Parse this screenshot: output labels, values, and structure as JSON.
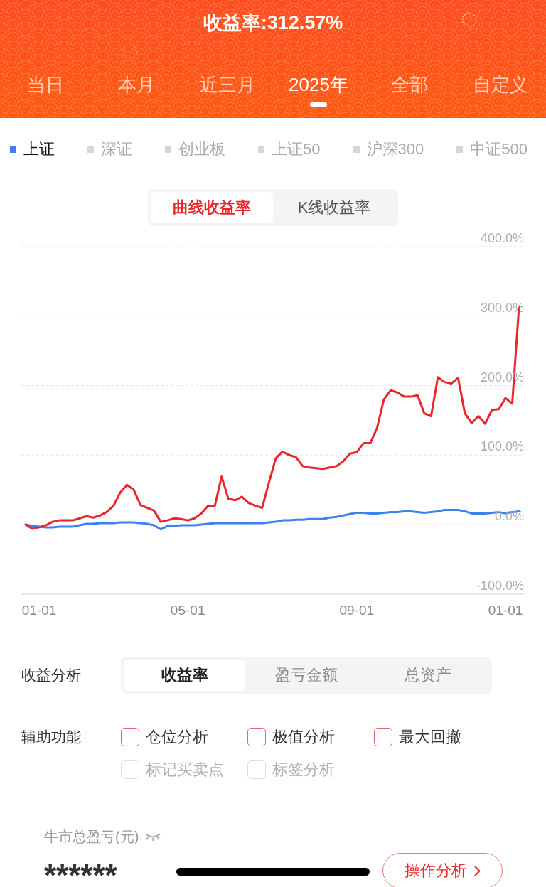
{
  "header": {
    "title": "收益率:312.57%",
    "tabs": [
      {
        "label": "当日",
        "selected": false
      },
      {
        "label": "本月",
        "selected": false
      },
      {
        "label": "近三月",
        "selected": false
      },
      {
        "label": "2025年",
        "selected": true
      },
      {
        "label": "全部",
        "selected": false
      },
      {
        "label": "自定义",
        "selected": false
      }
    ]
  },
  "benchmarks": [
    {
      "label": "上证",
      "selected": true
    },
    {
      "label": "深证",
      "selected": false
    },
    {
      "label": "创业板",
      "selected": false
    },
    {
      "label": "上证50",
      "selected": false
    },
    {
      "label": "沪深300",
      "selected": false
    },
    {
      "label": "中证500",
      "selected": false
    }
  ],
  "chart_modes": [
    {
      "label": "曲线收益率",
      "selected": true
    },
    {
      "label": "K线收益率",
      "selected": false
    }
  ],
  "chart": {
    "chart_data": {
      "type": "line",
      "grid": true,
      "categories": [
        null,
        null,
        "01-01",
        null,
        null,
        null,
        null,
        null,
        null,
        null,
        null,
        null,
        null,
        null,
        null,
        null,
        null,
        null,
        null,
        null,
        null,
        null,
        null,
        null,
        "05-01",
        null,
        null,
        null,
        null,
        null,
        null,
        null,
        null,
        null,
        null,
        null,
        null,
        null,
        null,
        null,
        null,
        null,
        null,
        null,
        null,
        null,
        null,
        null,
        null,
        "09-01",
        null,
        null,
        null,
        null,
        null,
        null,
        null,
        null,
        null,
        null,
        null,
        null,
        null,
        null,
        null,
        null,
        null,
        null,
        null,
        null,
        null,
        "01-01",
        null,
        null
      ],
      "ylim": [
        -100,
        400
      ],
      "yticks": [
        {
          "value": 400,
          "label": "400.0%"
        },
        {
          "value": 300,
          "label": "300.0%"
        },
        {
          "value": 200,
          "label": "200.0%"
        },
        {
          "value": 100,
          "label": "100.0%"
        },
        {
          "value": 0,
          "label": "0.0%"
        },
        {
          "value": -100,
          "label": "-100.0%"
        }
      ],
      "series": [
        {
          "color": "#e8262b",
          "values": [
            0,
            -6,
            -4,
            -1,
            4,
            6,
            6,
            6,
            9,
            12,
            10,
            13,
            18,
            27,
            46,
            57,
            50,
            28,
            24,
            20,
            4,
            6,
            9,
            8,
            6,
            9,
            16,
            27,
            27,
            69,
            37,
            35,
            40,
            31,
            27,
            24,
            60,
            95,
            105,
            100,
            97,
            84,
            82,
            81,
            80,
            82,
            84,
            91,
            102,
            104,
            117,
            117,
            139,
            180,
            193,
            190,
            184,
            184,
            186,
            160,
            156,
            212,
            205,
            203,
            211,
            160,
            146,
            156,
            145,
            165,
            166,
            182,
            174,
            313
          ]
        },
        {
          "color": "#3b82f0",
          "values": [
            0,
            -2,
            -3,
            -4,
            -4,
            -3,
            -3,
            -3,
            -1,
            1,
            1,
            2,
            2,
            2,
            3,
            3,
            3,
            2,
            1,
            -1,
            -7,
            -2,
            -2,
            -1,
            -1,
            -1,
            0,
            1,
            2,
            2,
            2,
            2,
            2,
            2,
            2,
            2,
            3,
            4,
            6,
            6,
            7,
            7,
            8,
            8,
            8,
            10,
            11,
            13,
            15,
            17,
            17,
            16,
            16,
            17,
            18,
            18,
            19,
            19,
            18,
            17,
            18,
            19,
            21,
            21,
            21,
            19,
            16,
            16,
            16,
            17,
            18,
            16,
            18,
            19
          ]
        }
      ]
    }
  },
  "analysis": {
    "label": "收益分析",
    "options": [
      {
        "label": "收益率",
        "selected": true
      },
      {
        "label": "盈亏金额",
        "selected": false
      },
      {
        "label": "总资产",
        "selected": false
      }
    ]
  },
  "tools": {
    "label": "辅助功能",
    "options": [
      {
        "label": "仓位分析",
        "checked": false,
        "disabled": false
      },
      {
        "label": "极值分析",
        "checked": false,
        "disabled": false
      },
      {
        "label": "最大回撤",
        "checked": false,
        "disabled": false
      },
      {
        "label": "标记买卖点",
        "checked": false,
        "disabled": true
      },
      {
        "label": "标签分析",
        "checked": false,
        "disabled": true
      }
    ]
  },
  "summary": {
    "label": "牛市总盈亏(元)",
    "value": "******",
    "button": "操作分析"
  }
}
